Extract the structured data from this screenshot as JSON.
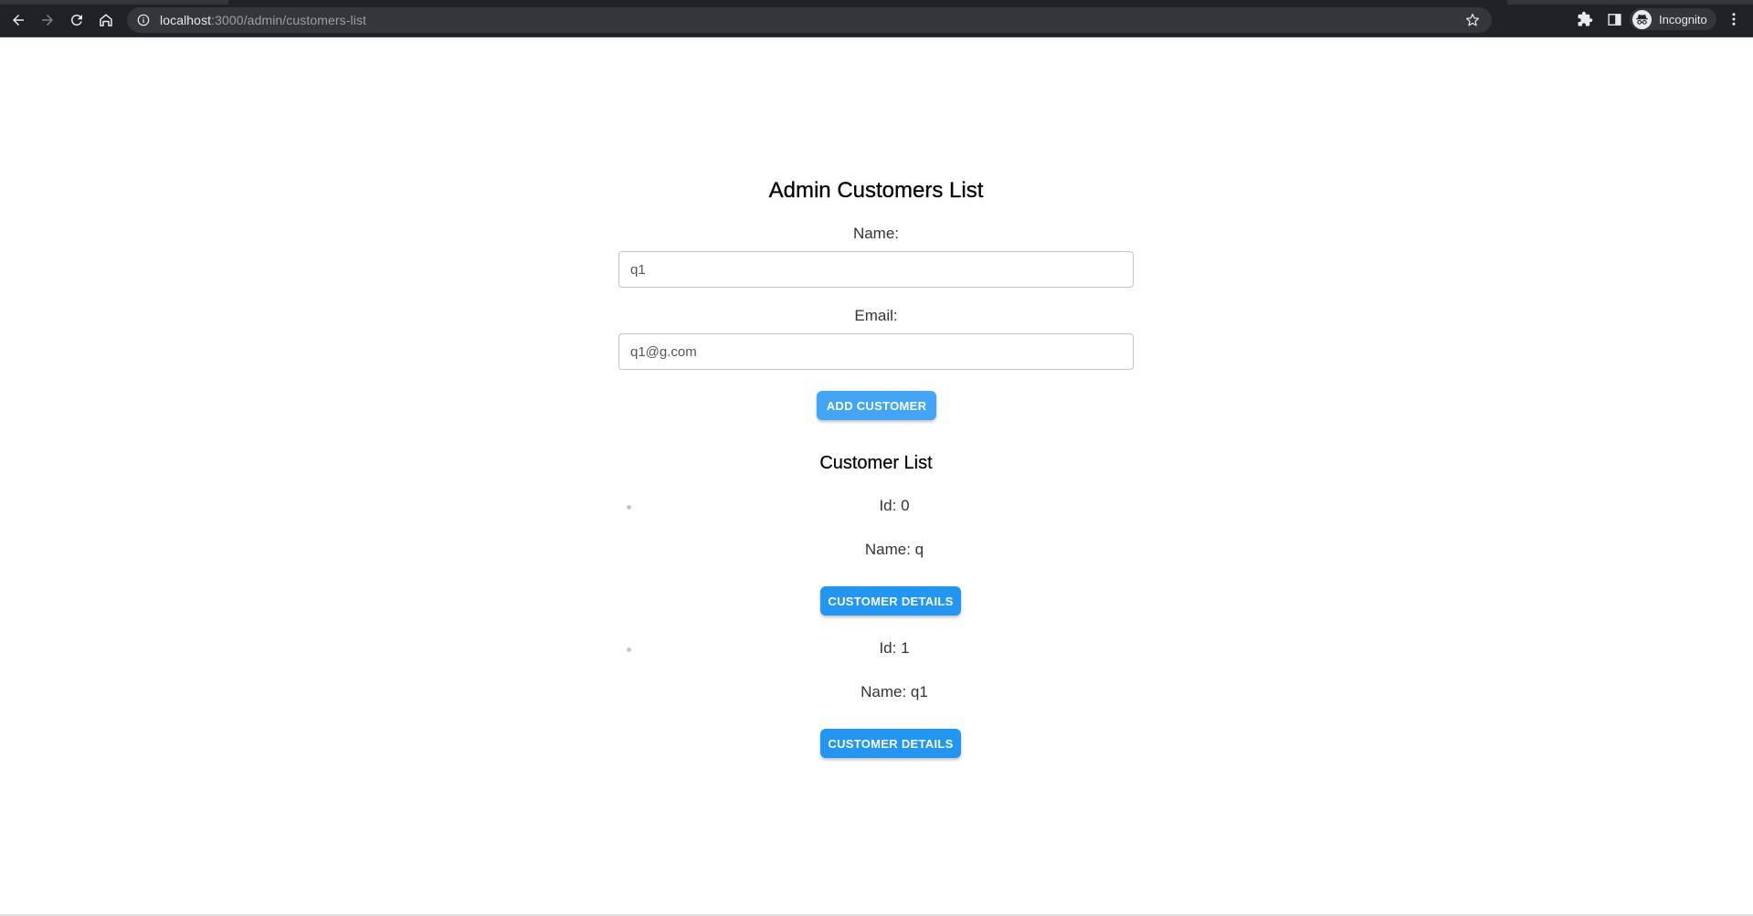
{
  "browser": {
    "url_host": "localhost",
    "url_rest": ":3000/admin/customers-list",
    "profile_label": "Incognito",
    "icons": [
      "back-icon",
      "forward-icon",
      "reload-icon",
      "home-icon",
      "info-icon",
      "star-icon",
      "extensions-icon",
      "side-panel-icon",
      "incognito-icon",
      "menu-icon"
    ]
  },
  "page": {
    "title": "Admin Customers List",
    "form": {
      "name_label": "Name:",
      "name_value": "q1",
      "email_label": "Email:",
      "email_value": "q1@g.com",
      "add_button": "ADD CUSTOMER"
    },
    "list_title": "Customer List",
    "customers": [
      {
        "id_text": "Id: 0",
        "name_text": "Name: q",
        "button": "CUSTOMER DETAILS"
      },
      {
        "id_text": "Id: 1",
        "name_text": "Name: q1",
        "button": "CUSTOMER DETAILS"
      }
    ]
  },
  "colors": {
    "chrome_bg": "#202124",
    "omnibox_bg": "#35363a",
    "button_primary": "#2196f3",
    "button_add": "#42a5f5"
  }
}
